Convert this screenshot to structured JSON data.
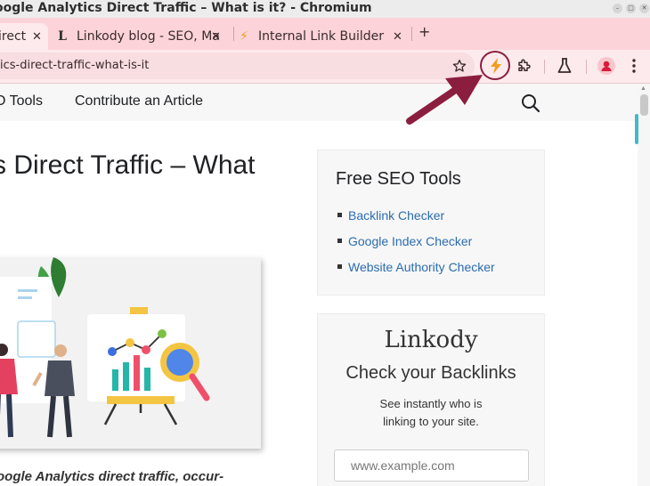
{
  "window": {
    "title": "oogle Analytics Direct Traffic – What is it? - Chromium",
    "controls": [
      "–",
      "□",
      "✕"
    ]
  },
  "tabs": [
    {
      "label": "irect",
      "favicon": "",
      "close": "✕",
      "active": true
    },
    {
      "label": "Linkody blog - SEO, Ma",
      "favicon": "L",
      "close": "✕",
      "active": false
    },
    {
      "label": "Internal Link Builder",
      "favicon": "⚡",
      "close": "✕",
      "active": false
    }
  ],
  "new_tab_label": "+",
  "toolbar": {
    "url": "ics-direct-traffic-what-is-it",
    "bookmark_icon": "star-icon",
    "extension_icon": "lightning-bolt-icon",
    "extensions_menu_icon": "puzzle-piece-icon",
    "labs_icon": "flask-icon",
    "profile_icon": "profile-avatar-icon",
    "menu_icon": "kebab-menu-icon",
    "highlight_color": "#8b1e3f"
  },
  "site_nav": {
    "items": [
      "O Tools",
      "Contribute an Article"
    ],
    "search_icon": "search-icon"
  },
  "article": {
    "title": "s Direct Traffic – What",
    "intro": "oogle Analytics direct traffic, occur-"
  },
  "sidebar": {
    "seo_tools": {
      "title": "Free SEO Tools",
      "items": [
        "Backlink Checker",
        "Google Index Checker",
        "Website Authority Checker"
      ]
    },
    "backlinks": {
      "logo": "Linkody",
      "title": "Check your Backlinks",
      "text_line1": "See instantly who is",
      "text_line2": "linking to your site.",
      "input_placeholder": "www.example.com"
    }
  },
  "colors": {
    "tab_strip": "#fcd3d8",
    "toolbar": "#fdeaec",
    "link": "#2b6cb0",
    "arrow": "#8b1e3f",
    "extension_bolt": "#f29d1f"
  }
}
